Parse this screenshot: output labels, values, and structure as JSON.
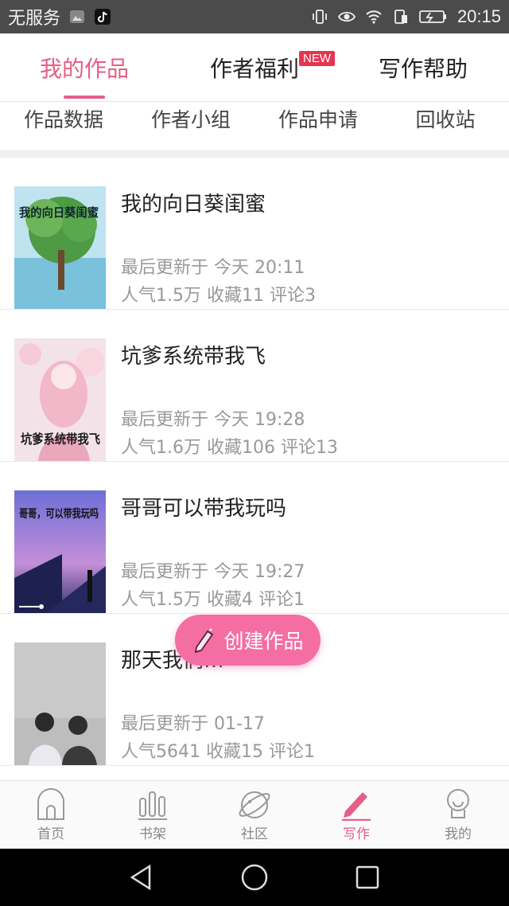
{
  "status": {
    "carrier": "无服务",
    "time": "20:15"
  },
  "top_tabs": [
    {
      "label": "我的作品",
      "active": true
    },
    {
      "label": "作者福利",
      "badge": "NEW"
    },
    {
      "label": "写作帮助"
    }
  ],
  "sub_tabs": [
    "作品数据",
    "作者小组",
    "作品申请",
    "回收站"
  ],
  "works": [
    {
      "title": "我的向日葵闺蜜",
      "updated": "最后更新于 今天 20:11",
      "stats": "人气1.5万 收藏11 评论3",
      "cover_text": "我的向日葵闺蜜"
    },
    {
      "title": "坑爹系统带我飞",
      "updated": "最后更新于 今天 19:28",
      "stats": "人气1.6万 收藏106 评论13",
      "cover_text": "坑爹系统带我飞"
    },
    {
      "title": "哥哥可以带我玩吗",
      "updated": "最后更新于 今天 19:27",
      "stats": "人气1.5万 收藏4 评论1",
      "cover_text": "哥哥，可以带我玩吗"
    },
    {
      "title": "那天我们…",
      "updated": "最后更新于 01-17",
      "stats": "人气5641 收藏15 评论1"
    }
  ],
  "fab": {
    "label": "创建作品",
    "icon": "pencil-icon"
  },
  "bottom_nav": [
    {
      "label": "首页",
      "icon": "home-icon"
    },
    {
      "label": "书架",
      "icon": "bookshelf-icon"
    },
    {
      "label": "社区",
      "icon": "planet-icon"
    },
    {
      "label": "写作",
      "icon": "pen-icon",
      "active": true
    },
    {
      "label": "我的",
      "icon": "profile-icon"
    }
  ],
  "colors": {
    "accent": "#e45f86",
    "fab": "#f46ea3",
    "badge": "#e6364f"
  }
}
